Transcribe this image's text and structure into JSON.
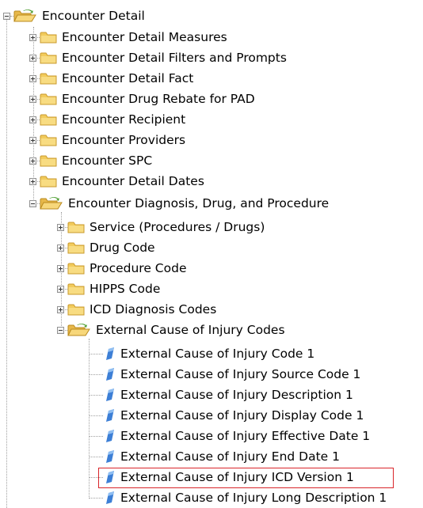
{
  "tree": {
    "root": {
      "label": "Encounter Detail",
      "icon": "folder-open-icon",
      "state": "expanded"
    },
    "level1": [
      {
        "label": "Encounter Detail Measures",
        "icon": "folder-icon",
        "state": "collapsed"
      },
      {
        "label": "Encounter Detail Filters and Prompts",
        "icon": "folder-icon",
        "state": "collapsed"
      },
      {
        "label": "Encounter Detail Fact",
        "icon": "folder-icon",
        "state": "collapsed"
      },
      {
        "label": "Encounter Drug Rebate for PAD",
        "icon": "folder-icon",
        "state": "collapsed"
      },
      {
        "label": "Encounter Recipient",
        "icon": "folder-icon",
        "state": "collapsed"
      },
      {
        "label": "Encounter Providers",
        "icon": "folder-icon",
        "state": "collapsed"
      },
      {
        "label": "Encounter SPC",
        "icon": "folder-icon",
        "state": "collapsed"
      },
      {
        "label": "Encounter Detail Dates",
        "icon": "folder-icon",
        "state": "collapsed"
      },
      {
        "label": "Encounter Diagnosis, Drug, and Procedure",
        "icon": "folder-open-icon",
        "state": "expanded"
      }
    ],
    "level2": [
      {
        "label": "Service (Procedures / Drugs)",
        "icon": "folder-icon",
        "state": "collapsed"
      },
      {
        "label": "Drug Code",
        "icon": "folder-icon",
        "state": "collapsed"
      },
      {
        "label": "Procedure Code",
        "icon": "folder-icon",
        "state": "collapsed"
      },
      {
        "label": "HIPPS Code",
        "icon": "folder-icon",
        "state": "collapsed"
      },
      {
        "label": "ICD Diagnosis Codes",
        "icon": "folder-icon",
        "state": "collapsed"
      },
      {
        "label": "External Cause of Injury Codes",
        "icon": "folder-open-icon",
        "state": "expanded"
      }
    ],
    "level3": [
      {
        "label": "External Cause of Injury Code 1",
        "icon": "dimension-object-icon"
      },
      {
        "label": "External Cause of Injury Source Code 1",
        "icon": "dimension-object-icon"
      },
      {
        "label": "External Cause of Injury Description 1",
        "icon": "dimension-object-icon"
      },
      {
        "label": "External Cause of Injury Display Code 1",
        "icon": "dimension-object-icon"
      },
      {
        "label": "External Cause of Injury Effective Date 1",
        "icon": "dimension-object-icon"
      },
      {
        "label": "External Cause of Injury End Date 1",
        "icon": "dimension-object-icon"
      },
      {
        "label": "External Cause of Injury ICD Version 1",
        "icon": "dimension-object-icon",
        "highlighted": true
      },
      {
        "label": "External Cause of Injury Long Description 1",
        "icon": "dimension-object-icon"
      }
    ]
  },
  "colors": {
    "highlight_border": "#d9252a",
    "folder": "#f2cb5c",
    "object_icon": "#3d7fd6"
  }
}
